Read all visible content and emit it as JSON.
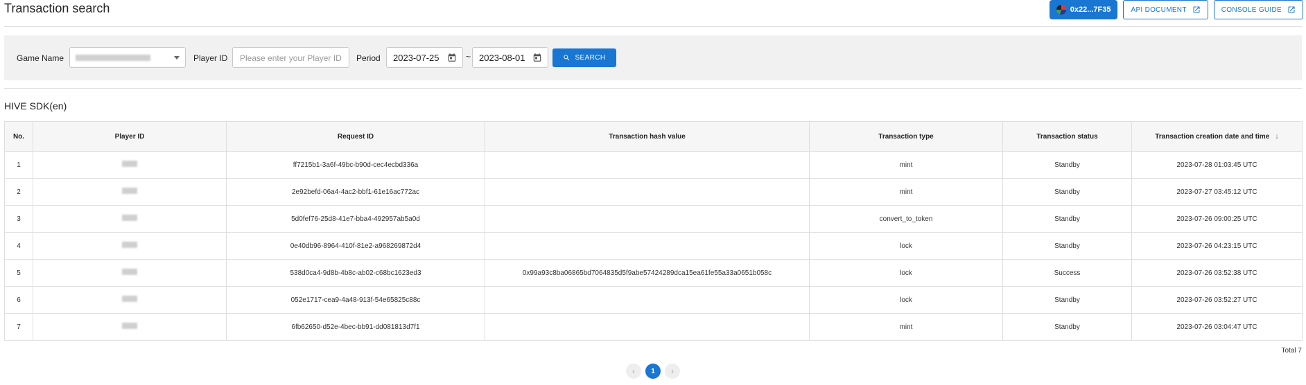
{
  "header": {
    "title": "Transaction search",
    "wallet_address": "0x22...7F35",
    "api_document_label": "API DOCUMENT",
    "console_guide_label": "CONSOLE GUIDE"
  },
  "filters": {
    "game_name_label": "Game Name",
    "player_id_label": "Player ID",
    "player_id_placeholder": "Please enter your Player ID",
    "period_label": "Period",
    "date_from": "2023-07-25",
    "date_to": "2023-08-01",
    "separator": "~",
    "search_label": "SEARCH"
  },
  "section_title": "HIVE SDK(en)",
  "table": {
    "columns": [
      "No.",
      "Player ID",
      "Request ID",
      "Transaction hash value",
      "Transaction type",
      "Transaction status",
      "Transaction creation date and time"
    ],
    "rows": [
      {
        "no": "1",
        "request_id": "ff7215b1-3a6f-49bc-b90d-cec4ecbd336a",
        "hash": "",
        "type": "mint",
        "status": "Standby",
        "created": "2023-07-28 01:03:45 UTC"
      },
      {
        "no": "2",
        "request_id": "2e92befd-06a4-4ac2-bbf1-61e16ac772ac",
        "hash": "",
        "type": "mint",
        "status": "Standby",
        "created": "2023-07-27 03:45:12 UTC"
      },
      {
        "no": "3",
        "request_id": "5d0fef76-25d8-41e7-bba4-492957ab5a0d",
        "hash": "",
        "type": "convert_to_token",
        "status": "Standby",
        "created": "2023-07-26 09:00:25 UTC"
      },
      {
        "no": "4",
        "request_id": "0e40db96-8964-410f-81e2-a968269872d4",
        "hash": "",
        "type": "lock",
        "status": "Standby",
        "created": "2023-07-26 04:23:15 UTC"
      },
      {
        "no": "5",
        "request_id": "538d0ca4-9d8b-4b8c-ab02-c68bc1623ed3",
        "hash": "0x99a93c8ba06865bd7064835d5f9abe57424289dca15ea61fe55a33a0651b058c",
        "type": "lock",
        "status": "Success",
        "created": "2023-07-26 03:52:38 UTC"
      },
      {
        "no": "6",
        "request_id": "052e1717-cea9-4a48-913f-54e65825c88c",
        "hash": "",
        "type": "lock",
        "status": "Standby",
        "created": "2023-07-26 03:52:27 UTC"
      },
      {
        "no": "7",
        "request_id": "6fb62650-d52e-4bec-bb91-dd081813d7f1",
        "hash": "",
        "type": "mint",
        "status": "Standby",
        "created": "2023-07-26 03:04:47 UTC"
      }
    ]
  },
  "footer": {
    "total_label": "Total 7",
    "current_page": "1",
    "prev_icon": "chevron-left-icon",
    "next_icon": "chevron-right-icon"
  },
  "colors": {
    "accent": "#1976d2",
    "panel_bg": "#f1f1f1",
    "header_bg": "#f6f6f6"
  }
}
